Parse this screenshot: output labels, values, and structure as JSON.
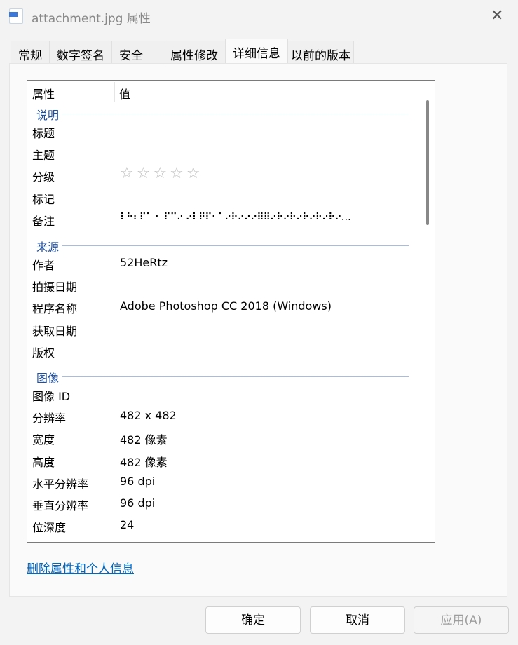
{
  "window": {
    "title": "attachment.jpg 属性",
    "close": "✕"
  },
  "tabs": [
    "常规",
    "数字签名",
    "安全",
    "属性修改",
    "详细信息",
    "以前的版本"
  ],
  "list": {
    "headers": {
      "property": "属性",
      "value": "值"
    },
    "groups": {
      "description": "说明",
      "origin": "来源",
      "image": "图像"
    },
    "description": [
      {
        "k": "标题",
        "v": ""
      },
      {
        "k": "主题",
        "v": ""
      },
      {
        "k": "分级",
        "v": "☆☆☆☆☆"
      },
      {
        "k": "标记",
        "v": ""
      },
      {
        "k": "备注",
        "v": "⠇⠓⠆⠏⠁ ⠂ ⠏⠉⠔ ⠔⠇⠟⠏⠂⠁⠔⠗⠔⠔⠔⠿⠿⠔⠗⠔⠗⠔⠗⠔⠗⠔⠗⠔…"
      }
    ],
    "origin": [
      {
        "k": "作者",
        "v": "52HeRtz"
      },
      {
        "k": "拍摄日期",
        "v": ""
      },
      {
        "k": "程序名称",
        "v": "Adobe Photoshop CC 2018 (Windows)"
      },
      {
        "k": "获取日期",
        "v": ""
      },
      {
        "k": "版权",
        "v": ""
      }
    ],
    "image": [
      {
        "k": "图像 ID",
        "v": ""
      },
      {
        "k": "分辨率",
        "v": "482 x 482"
      },
      {
        "k": "宽度",
        "v": "482 像素"
      },
      {
        "k": "高度",
        "v": "482 像素"
      },
      {
        "k": "水平分辨率",
        "v": "96 dpi"
      },
      {
        "k": "垂直分辨率",
        "v": "96 dpi"
      },
      {
        "k": "位深度",
        "v": "24"
      }
    ]
  },
  "remove_link": "删除属性和个人信息",
  "buttons": {
    "ok": "确定",
    "cancel": "取消",
    "apply": "应用(A)"
  }
}
